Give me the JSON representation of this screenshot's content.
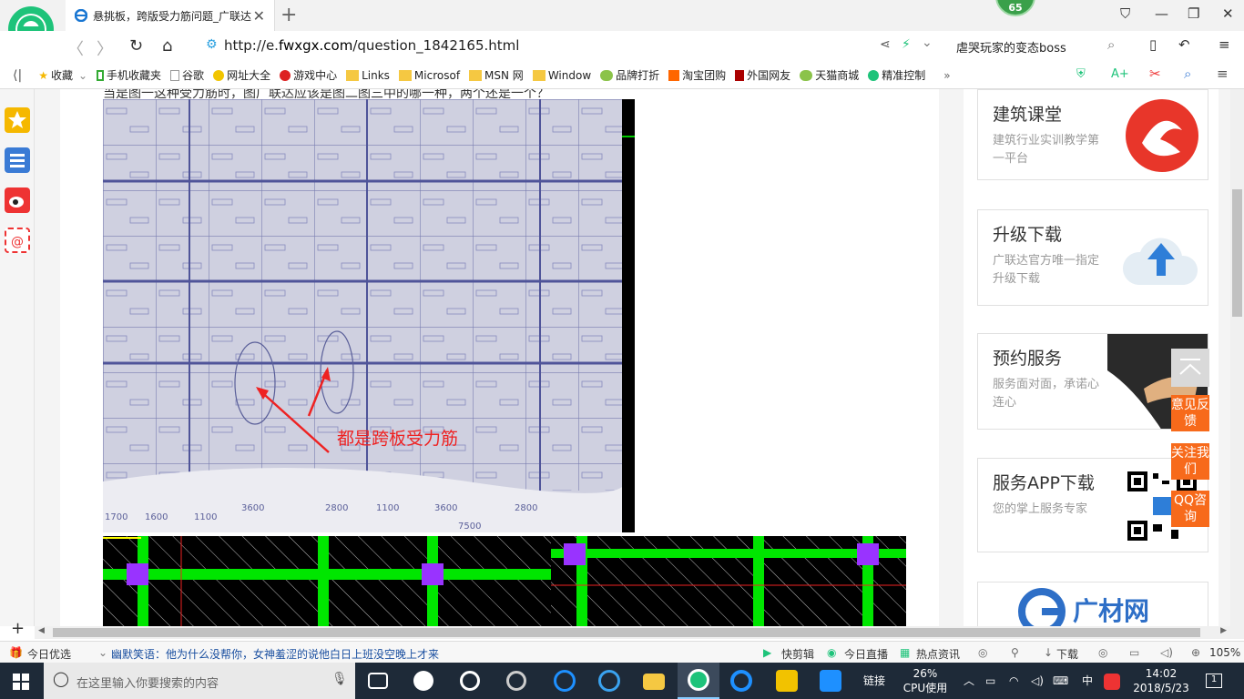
{
  "browser": {
    "tab_title": "悬挑板，跨版受力筋问题_广联达",
    "badge": "65",
    "url_prefix": "http://e.",
    "url_host": "fwxgx.com",
    "url_path": "/question_1842165.html",
    "search_text": "虐哭玩家的变态boss"
  },
  "bookmarks": [
    "收藏",
    "手机收藏夹",
    "谷歌",
    "网址大全",
    "游戏中心",
    "Links",
    "Microsof",
    "MSN 网",
    "Window",
    "品牌打折",
    "淘宝团购",
    "外国网友",
    "天猫商城",
    "精准控制"
  ],
  "question": {
    "top_text": "当是图一这种受力筋时，图广联达应该是图二图三中的哪一种，两个还是一个？",
    "annotation": "都是跨板受力筋",
    "dims": [
      "1700",
      "1600",
      "1100",
      "3600",
      "2800",
      "1100",
      "3600",
      "2800",
      "7500"
    ]
  },
  "sidebar_cards": [
    {
      "title": "建筑课堂",
      "desc": "建筑行业实训教学第一平台"
    },
    {
      "title": "升级下载",
      "desc": "广联达官方唯一指定升级下载"
    },
    {
      "title": "预约服务",
      "desc": "服务面对面，承诺心连心"
    },
    {
      "title": "服务APP下载",
      "desc": "您的掌上服务专家"
    },
    {
      "title": "广材网",
      "desc": ""
    }
  ],
  "float_buttons": [
    "意见反馈",
    "关注我们",
    "QQ咨询"
  ],
  "statusbar": {
    "today": "今日优选",
    "news": "幽默笑语：他为什么没帮你，女神羞涩的说他白日上班没空晚上才来",
    "items": [
      "快剪辑",
      "今日直播",
      "热点资讯",
      "下载"
    ],
    "zoom": "105%"
  },
  "taskbar": {
    "search_placeholder": "在这里输入你要搜索的内容",
    "link": "链接",
    "cpu_pct": "26%",
    "cpu_label": "CPU使用",
    "ime": "中",
    "time": "14:02",
    "date": "2018/5/23",
    "notif": "1"
  },
  "colors": {
    "accent": "#f76a1b",
    "green": "#00e600",
    "purple": "#9933ff"
  }
}
